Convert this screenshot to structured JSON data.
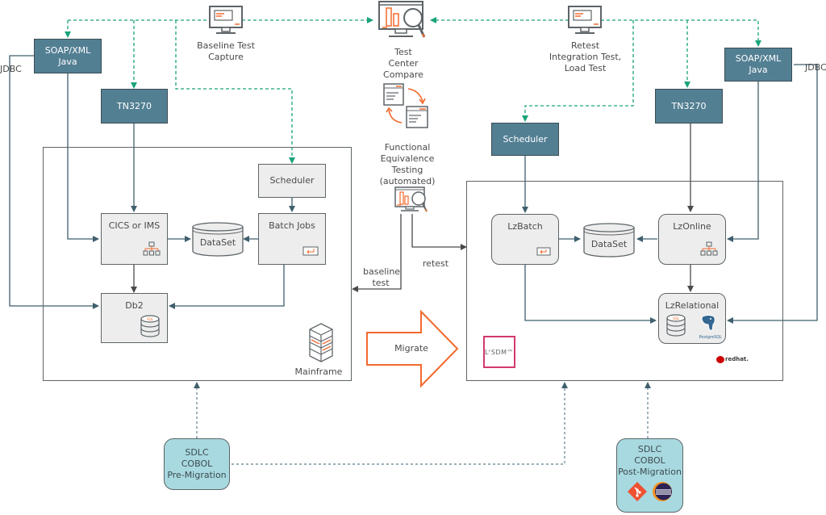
{
  "colors": {
    "dark_box": "#537f93",
    "grey_box": "#ededed",
    "teal_box": "#a8d9e0",
    "dashed_green": "#1aa37a",
    "wire": "#3f5f6d",
    "accent_orange": "#f26a2e",
    "lzsdm_border": "#d33a6a"
  },
  "top": {
    "baseline_capture": "Baseline Test\nCapture",
    "test_center": "Test\nCenter\nCompare",
    "retest": "Retest\nIntegration Test,\nLoad Test",
    "functional_equivalence": "Functional\nEquivalence\nTesting\n(automated)"
  },
  "left": {
    "soap": "SOAP/XML\nJava",
    "jdbc": "JDBC",
    "tn3270": "TN3270",
    "scheduler": "Scheduler",
    "cics": "CICS or IMS",
    "dataset": "DataSet",
    "batch_jobs": "Batch Jobs",
    "db2": "Db2",
    "mainframe": "Mainframe"
  },
  "right": {
    "soap": "SOAP/XML\nJava",
    "jdbc": "JDBC",
    "tn3270": "TN3270",
    "scheduler": "Scheduler",
    "lzbatch": "LzBatch",
    "dataset": "DataSet",
    "lzonline": "LzOnline",
    "lzrelational": "LzRelational",
    "lzsdm": "LᶠSDM™",
    "postgres": "PostgreSQL",
    "redhat": "redhat."
  },
  "middle": {
    "baseline_test": "baseline\ntest",
    "retest": "retest",
    "migrate": "Migrate"
  },
  "bottom": {
    "pre_migration": "SDLC\nCOBOL\nPre-Migration",
    "post_migration": "SDLC\nCOBOL\nPost-Migration"
  }
}
